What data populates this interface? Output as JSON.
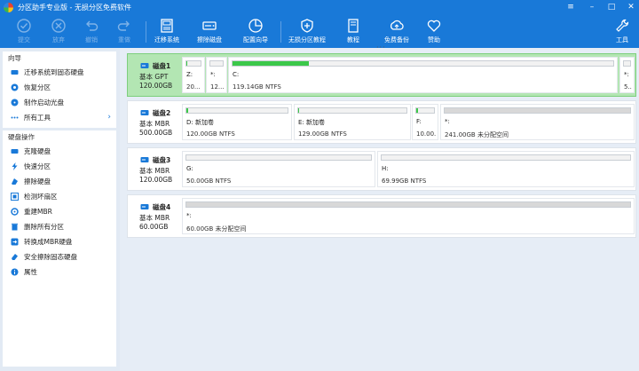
{
  "window": {
    "title": "分区助手专业版 - 无损分区免费软件"
  },
  "toolbar": {
    "items": [
      {
        "label": "提交",
        "icon": "commit-icon",
        "enabled": false
      },
      {
        "label": "放弃",
        "icon": "discard-icon",
        "enabled": false
      },
      {
        "label": "撤销",
        "icon": "undo-icon",
        "enabled": false
      },
      {
        "label": "重做",
        "icon": "redo-icon",
        "enabled": false
      },
      {
        "label": "迁移系统",
        "icon": "migrate-os-icon",
        "enabled": true
      },
      {
        "label": "擦除磁盘",
        "icon": "wipe-disk-icon",
        "enabled": true
      },
      {
        "label": "配置向导",
        "icon": "wizard-pie-icon",
        "enabled": true
      },
      {
        "label": "无损分区教程",
        "icon": "shield-plus-icon",
        "enabled": true
      },
      {
        "label": "教程",
        "icon": "book-icon",
        "enabled": true
      },
      {
        "label": "免费备份",
        "icon": "backup-icon",
        "enabled": true
      },
      {
        "label": "赞助",
        "icon": "heart-icon",
        "enabled": true
      },
      {
        "label": "工具",
        "icon": "tools-icon",
        "enabled": true
      }
    ]
  },
  "sidebar": {
    "wizard": {
      "title": "向导",
      "items": [
        {
          "label": "迁移系统到固态硬盘",
          "icon": "migrate-icon"
        },
        {
          "label": "恢复分区",
          "icon": "recover-icon"
        },
        {
          "label": "制作启动光盘",
          "icon": "boot-disc-icon"
        },
        {
          "label": "所有工具",
          "icon": "more-icon",
          "chevron": "›"
        }
      ]
    },
    "disk_ops": {
      "title": "硬盘操作",
      "items": [
        {
          "label": "克隆硬盘",
          "icon": "clone-icon"
        },
        {
          "label": "快速分区",
          "icon": "lightning-icon"
        },
        {
          "label": "擦除硬盘",
          "icon": "eraser-icon"
        },
        {
          "label": "检测坏扇区",
          "icon": "scan-icon"
        },
        {
          "label": "重建MBR",
          "icon": "rebuild-mbr-icon"
        },
        {
          "label": "删除所有分区",
          "icon": "delete-partitions-icon"
        },
        {
          "label": "转换成MBR硬盘",
          "icon": "convert-icon"
        },
        {
          "label": "安全擦除固态硬盘",
          "icon": "secure-erase-icon"
        },
        {
          "label": "属性",
          "icon": "info-icon"
        }
      ]
    }
  },
  "disks": [
    {
      "name": "磁盘1",
      "type": "基本 GPT",
      "size": "120.00GB",
      "selected": true,
      "partitions": [
        {
          "name": "Z:",
          "info": "20...",
          "used_fraction": 0.02,
          "unallocated": false
        },
        {
          "name": "*:",
          "info": "12...",
          "used_fraction": 0.0,
          "unallocated": false
        },
        {
          "name": "C:",
          "info": "119.14GB NTFS",
          "used_fraction": 0.2,
          "unallocated": false
        },
        {
          "name": "*:",
          "info": "5...",
          "used_fraction": 0.0,
          "unallocated": false
        }
      ]
    },
    {
      "name": "磁盘2",
      "type": "基本 MBR",
      "size": "500.00GB",
      "selected": false,
      "partitions": [
        {
          "name": "D: 新加卷",
          "info": "120.00GB NTFS",
          "used_fraction": 0.02,
          "unallocated": false
        },
        {
          "name": "E: 新加卷",
          "info": "129.00GB NTFS",
          "used_fraction": 0.01,
          "unallocated": false
        },
        {
          "name": "F:",
          "info": "10.00...",
          "used_fraction": 0.08,
          "unallocated": false
        },
        {
          "name": "*:",
          "info": "241.00GB 未分配空间",
          "used_fraction": 0.0,
          "unallocated": true
        }
      ]
    },
    {
      "name": "磁盘3",
      "type": "基本 MBR",
      "size": "120.00GB",
      "selected": false,
      "partitions": [
        {
          "name": "G:",
          "info": "50.00GB NTFS",
          "used_fraction": 0.0,
          "unallocated": false
        },
        {
          "name": "H:",
          "info": "69.99GB NTFS",
          "used_fraction": 0.0,
          "unallocated": false
        }
      ]
    },
    {
      "name": "磁盘4",
      "type": "基本 MBR",
      "size": "60.00GB",
      "selected": false,
      "partitions": [
        {
          "name": "*:",
          "info": "60.00GB 未分配空间",
          "used_fraction": 0.0,
          "unallocated": true
        }
      ]
    }
  ],
  "colors": {
    "accent": "#1979d8",
    "used_fill": "#3cc84a",
    "selected_row": "#b3e6b3"
  }
}
